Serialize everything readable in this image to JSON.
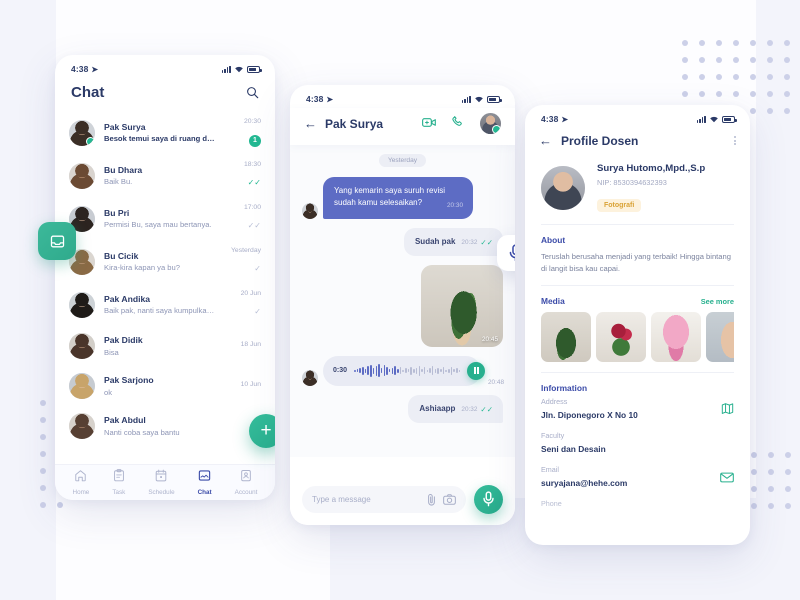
{
  "status_bar": {
    "time": "4:38"
  },
  "left_phone": {
    "title": "Chat",
    "search_icon": "search-icon",
    "side_tab_icon": "inbox-icon",
    "fab_label": "+",
    "conversations": [
      {
        "name": "Pak Surya",
        "message": "Besok temui saya di ruang dosen.",
        "time": "20:30",
        "unread": "1",
        "status": "unread",
        "online": true,
        "unread_bold": true
      },
      {
        "name": "Bu Dhara",
        "message": "Baik Bu.",
        "time": "18:30",
        "unread": "",
        "status": "read",
        "online": false,
        "unread_bold": false
      },
      {
        "name": "Bu Pri",
        "message": "Permisi Bu, saya mau bertanya.",
        "time": "17:00",
        "unread": "",
        "status": "delivered",
        "online": false,
        "unread_bold": false
      },
      {
        "name": "Bu Cicik",
        "message": "Kira-kira kapan ya bu?",
        "time": "Yesterday",
        "unread": "",
        "status": "sent",
        "online": false,
        "unread_bold": false
      },
      {
        "name": "Pak Andika",
        "message": "Baik pak, nanti saya kumpulkan ke…",
        "time": "20 Jun",
        "unread": "",
        "status": "sent",
        "online": false,
        "unread_bold": false
      },
      {
        "name": "Pak Didik",
        "message": "Bisa",
        "time": "18 Jun",
        "unread": "",
        "status": "none",
        "online": false,
        "unread_bold": false
      },
      {
        "name": "Pak Sarjono",
        "message": "ok",
        "time": "10 Jun",
        "unread": "",
        "status": "none",
        "online": false,
        "unread_bold": false
      },
      {
        "name": "Pak Abdul",
        "message": "Nanti coba saya bantu",
        "time": "",
        "unread": "",
        "status": "none",
        "online": false,
        "unread_bold": false
      }
    ],
    "bottom_nav": [
      {
        "label": "Home",
        "icon": "home-icon",
        "active": false
      },
      {
        "label": "Task",
        "icon": "clipboard-icon",
        "active": false
      },
      {
        "label": "Schedule",
        "icon": "calendar-icon",
        "active": false
      },
      {
        "label": "Chat",
        "icon": "chat-icon",
        "active": true
      },
      {
        "label": "Account",
        "icon": "person-icon",
        "active": false
      }
    ]
  },
  "middle_phone": {
    "back_icon": "back-arrow-icon",
    "contact_name": "Pak Surya",
    "video_icon": "video-camera-icon",
    "call_icon": "phone-icon",
    "day_divider": "Yesterday",
    "messages": [
      {
        "type": "text",
        "dir": "in",
        "text": "Yang kemarin saya suruh revisi sudah kamu selesaikan?",
        "time": "20:30",
        "status": "none"
      },
      {
        "type": "text",
        "dir": "out",
        "text": "Sudah pak",
        "time": "20:32",
        "status": "read"
      },
      {
        "type": "image",
        "dir": "out",
        "text": "",
        "time": "20:45",
        "status": "none"
      },
      {
        "type": "voice",
        "dir": "in",
        "text": "",
        "time": "20:48",
        "status": "none",
        "duration": "0:30"
      },
      {
        "type": "text",
        "dir": "out",
        "text": "Ashiaapp",
        "time": "20:32",
        "status": "read"
      }
    ],
    "floating_mic_icon": "microphone-icon",
    "input_placeholder": "Type a message",
    "attach_icon": "paperclip-icon",
    "camera_icon": "camera-icon",
    "send_mic_icon": "microphone-icon"
  },
  "right_phone": {
    "back_icon": "back-arrow-icon",
    "title": "Profile Dosen",
    "menu_icon": "kebab-menu-icon",
    "person_name": "Surya Hutomo,Mpd.,S.p",
    "nip": "NIP: 8530394632393",
    "tag": "Fotografi",
    "about_title": "About",
    "about_text": "Teruslah berusaha menjadi yang terbaik! Hingga bintang di langit bisa kau capai.",
    "media_title": "Media",
    "see_more": "See more",
    "media_count": 4,
    "info_title": "Information",
    "info_items": [
      {
        "label": "Address",
        "value": "Jln. Diponegoro X No 10",
        "icon": "map-icon"
      },
      {
        "label": "Faculty",
        "value": "Seni dan Desain",
        "icon": ""
      },
      {
        "label": "Email",
        "value": "suryajana@hehe.com",
        "icon": "envelope-icon"
      }
    ],
    "cut_label": "Phone"
  },
  "colors": {
    "accent_green": "#27b08e",
    "bubble_in": "#5d6cc4",
    "bubble_out": "#eceef5",
    "text_dark": "#2b3a67",
    "text_muted": "#a8aec8",
    "tag_bg": "#fdf2dd",
    "tag_text": "#d9a236",
    "page_bg": "#f3f4fb"
  }
}
